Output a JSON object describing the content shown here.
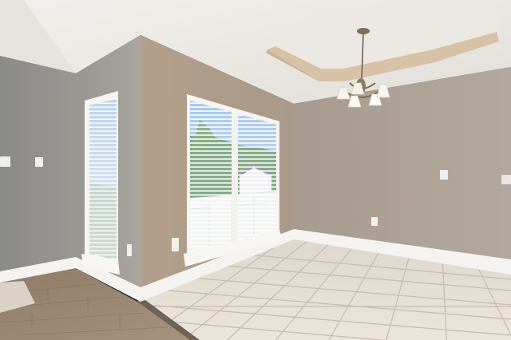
{
  "scene": {
    "subject": "empty room",
    "colors": {
      "wall_warm": "#b6a899",
      "wall_cool": "#8e8c88",
      "ceiling": "#e9e6e1",
      "trim": "#f4f3ef",
      "tile": "#e4ddd3",
      "grout": "#c9c0b3",
      "wood": "#9c8a76",
      "sky": "#9fc3e8",
      "foliage": "#3f7a3a"
    },
    "icons": [
      "chandelier-icon",
      "light-switch-icon",
      "outlet-icon",
      "window-blinds-icon"
    ]
  }
}
